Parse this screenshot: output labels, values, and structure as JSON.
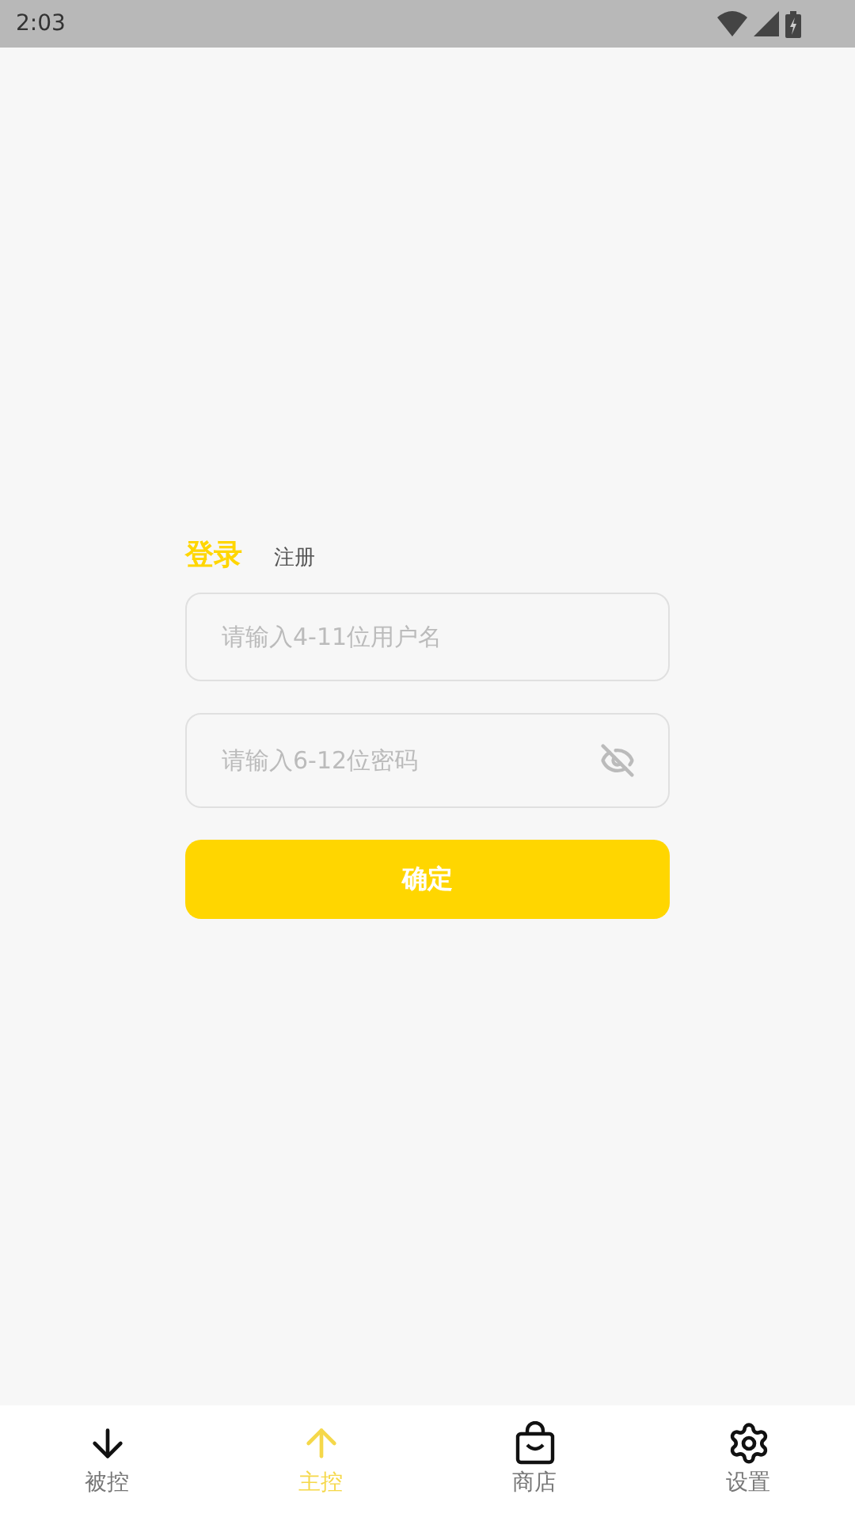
{
  "status_bar": {
    "time": "2:03"
  },
  "auth_tabs": [
    {
      "label": "登录",
      "selected": true
    },
    {
      "label": "注册",
      "selected": false
    }
  ],
  "fields": [
    {
      "placeholder": "请输入4-11位用户名",
      "kind": "text"
    },
    {
      "placeholder": "请输入6-12位密码",
      "kind": "password"
    }
  ],
  "submit_button": "确定",
  "bottom_nav": [
    {
      "label": "被控",
      "kind": "down",
      "selected": false
    },
    {
      "label": "主控",
      "kind": "up",
      "selected": true
    },
    {
      "label": "商店",
      "kind": "bag",
      "selected": false
    },
    {
      "label": "设置",
      "kind": "gear",
      "selected": false
    }
  ]
}
